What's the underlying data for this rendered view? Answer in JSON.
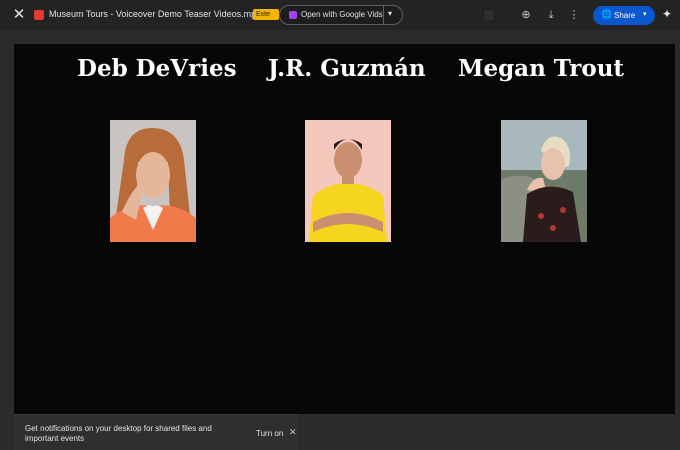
{
  "header": {
    "file_title": "Museum Tours - Voiceover Demo Teaser Videos.mp4",
    "badge": "Exte",
    "open_with": "Open with Google Vids",
    "share": "Share"
  },
  "icons": {
    "close": "✕",
    "caret": "▾",
    "add_shortcut": "⊕",
    "download": "⤓",
    "more": "⋮",
    "globe": "🌐",
    "gemini": "✦",
    "grid": "▦"
  },
  "video": {
    "people": [
      {
        "name": "Deb DeVries"
      },
      {
        "name": "J.R. Guzmán"
      },
      {
        "name": "Megan Trout"
      }
    ]
  },
  "toast": {
    "message": "Get notifications on your desktop for shared files and important events",
    "action": "Turn on"
  },
  "colors": {
    "share_button": "#0b57d0",
    "badge": "#f5b400",
    "video_background": "#070707"
  }
}
